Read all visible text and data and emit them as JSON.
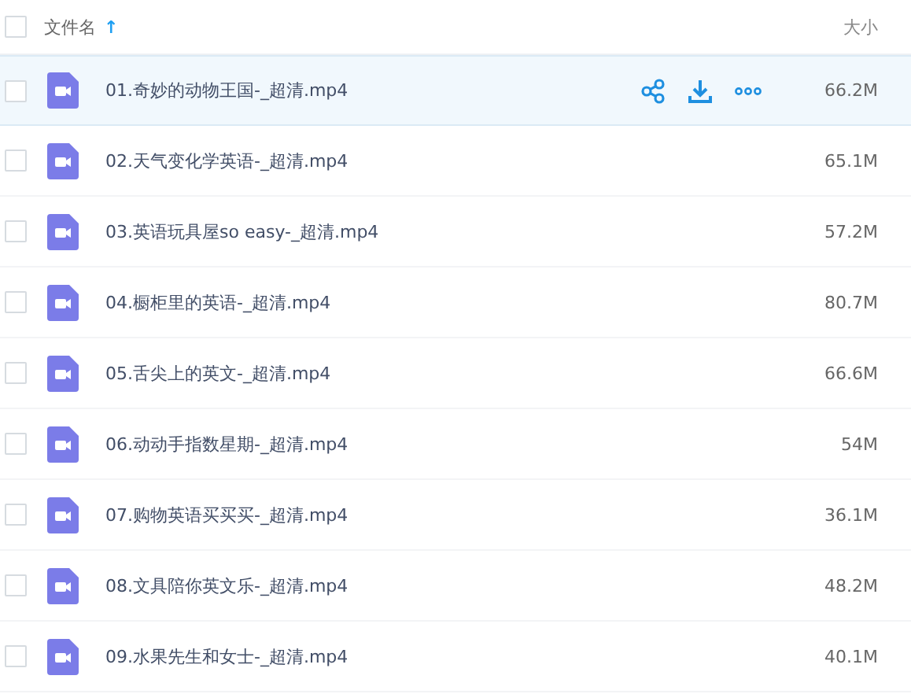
{
  "header": {
    "name_column": "文件名",
    "sort_arrow": "↑",
    "size_column": "大小",
    "checked": false
  },
  "rows": [
    {
      "name": "01.奇妙的动物王国-_超清.mp4",
      "size": "66.2M",
      "highlighted": true,
      "checked": false
    },
    {
      "name": "02.天气变化学英语-_超清.mp4",
      "size": "65.1M",
      "highlighted": false,
      "checked": false
    },
    {
      "name": "03.英语玩具屋so easy-_超清.mp4",
      "size": "57.2M",
      "highlighted": false,
      "checked": false
    },
    {
      "name": "04.橱柜里的英语-_超清.mp4",
      "size": "80.7M",
      "highlighted": false,
      "checked": false
    },
    {
      "name": "05.舌尖上的英文-_超清.mp4",
      "size": "66.6M",
      "highlighted": false,
      "checked": false
    },
    {
      "name": "06.动动手指数星期-_超清.mp4",
      "size": "54M",
      "highlighted": false,
      "checked": false
    },
    {
      "name": "07.购物英语买买买-_超清.mp4",
      "size": "36.1M",
      "highlighted": false,
      "checked": false
    },
    {
      "name": "08.文具陪你英文乐-_超清.mp4",
      "size": "48.2M",
      "highlighted": false,
      "checked": false
    },
    {
      "name": "09.水果先生和女士-_超清.mp4",
      "size": "40.1M",
      "highlighted": false,
      "checked": false
    }
  ]
}
